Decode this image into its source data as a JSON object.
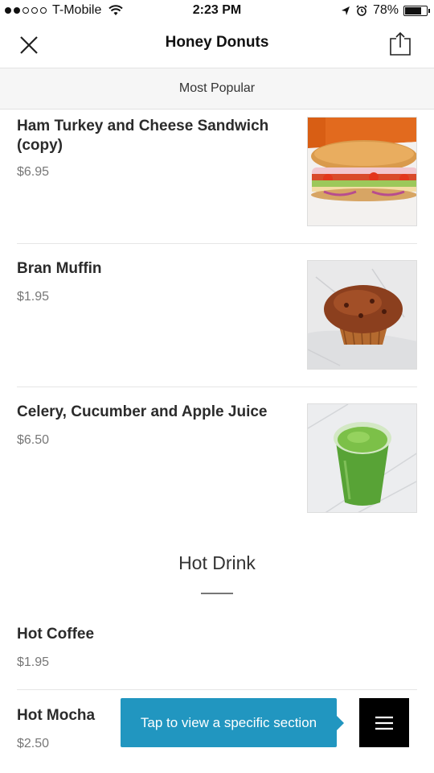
{
  "status_bar": {
    "carrier": "T-Mobile",
    "time": "2:23 PM",
    "battery": "78%",
    "battery_level": 0.78,
    "signal_dots_filled": 2,
    "signal_dots_total": 5
  },
  "header": {
    "title": "Honey Donuts",
    "close_icon": "close-icon",
    "share_icon": "share-icon"
  },
  "section_bar": {
    "label": "Most Popular"
  },
  "popular_items": [
    {
      "name": "Ham Turkey and Cheese Sandwich (copy)",
      "price": "$6.95",
      "image": "sandwich"
    },
    {
      "name": "Bran Muffin",
      "price": "$1.95",
      "image": "muffin"
    },
    {
      "name": "Celery, Cucumber and Apple Juice",
      "price": "$6.50",
      "image": "green-juice"
    }
  ],
  "hot_drink_section": {
    "title": "Hot Drink",
    "items": [
      {
        "name": "Hot Coffee",
        "price": "$1.95"
      },
      {
        "name": "Hot Mocha",
        "price": "$2.50"
      }
    ]
  },
  "tooltip": {
    "text": "Tap to view a specific section"
  },
  "menu_button": {
    "icon": "hamburger-menu-icon"
  }
}
